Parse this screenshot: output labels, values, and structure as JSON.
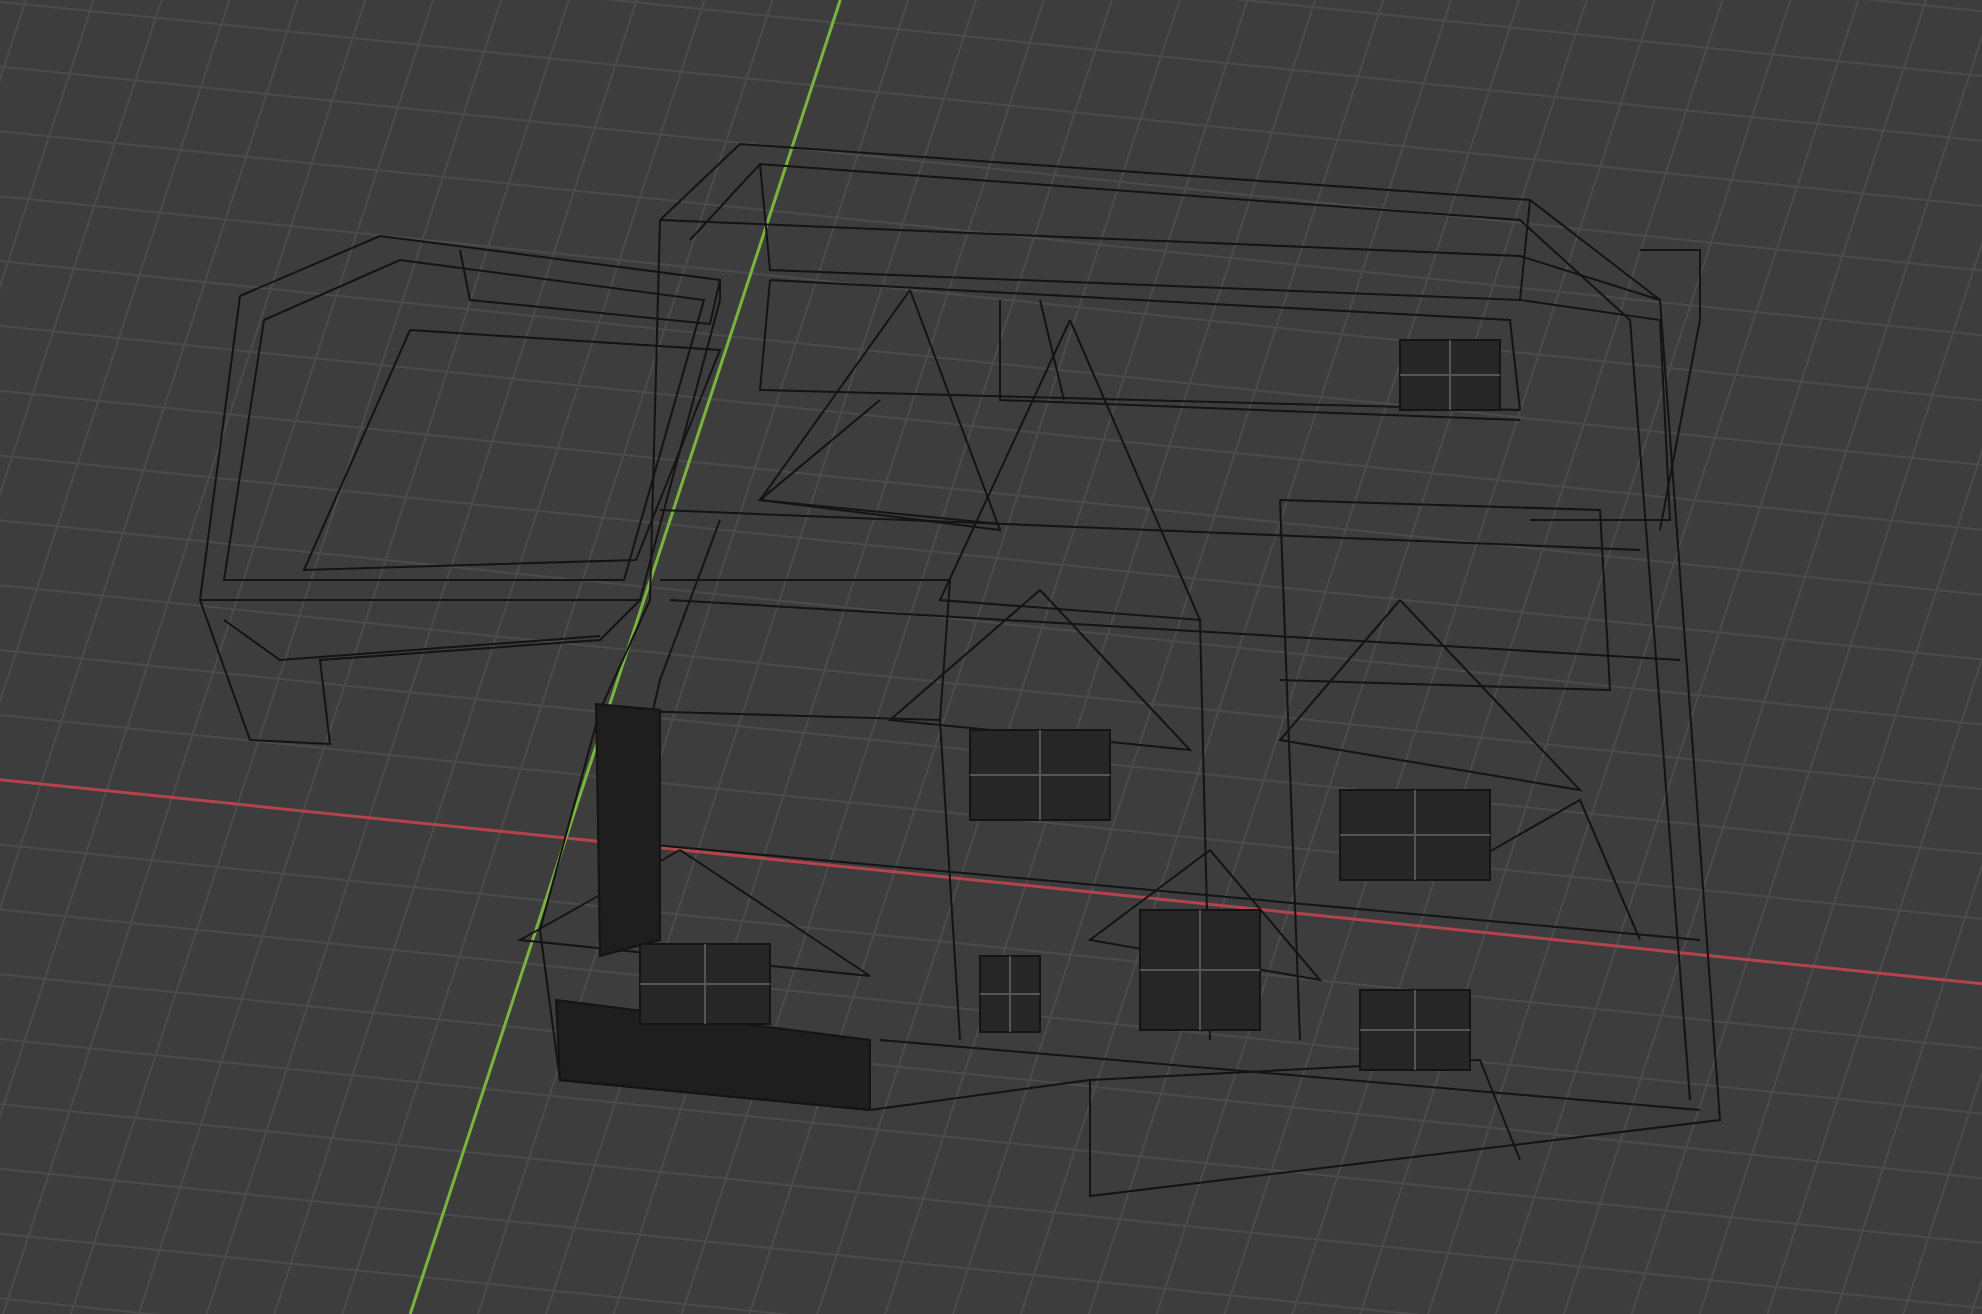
{
  "viewport": {
    "axes": [
      {
        "color": "#b5434c"
      },
      {
        "color": "#7bb33f"
      }
    ]
  }
}
